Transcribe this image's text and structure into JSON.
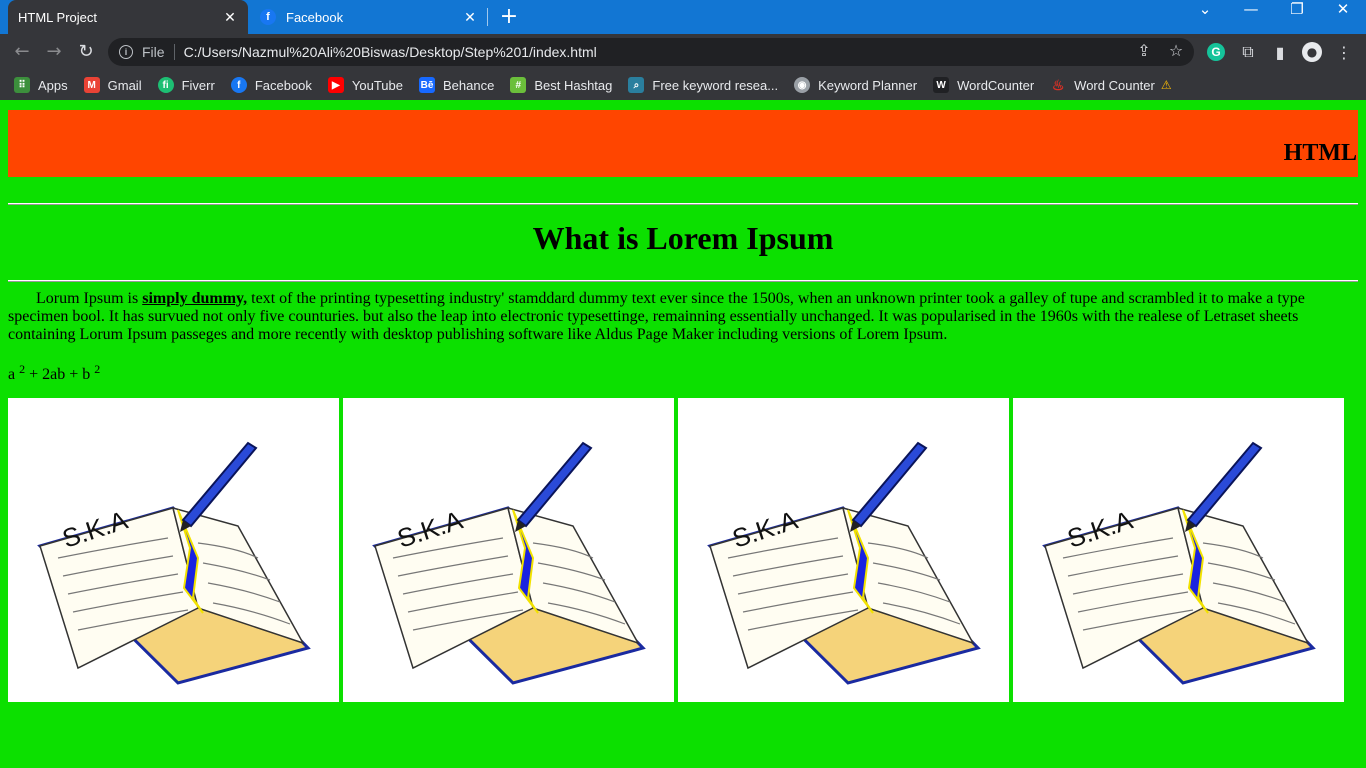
{
  "browser": {
    "tabs": [
      {
        "title": "HTML Project",
        "favicon": "page-icon",
        "active": true
      },
      {
        "title": "Facebook",
        "favicon": "facebook-icon",
        "active": false
      }
    ],
    "new_tab": "+",
    "window_controls": {
      "minimize": "—",
      "restore": "❐",
      "close": "✕"
    },
    "address": {
      "scheme": "File",
      "url": "C:/Users/Nazmul%20Ali%20Biswas/Desktop/Step%201/index.html"
    },
    "bookmarks": [
      {
        "label": "Apps",
        "icon": "apps-grid-icon",
        "color": "#f4b400"
      },
      {
        "label": "Gmail",
        "icon": "gmail-icon",
        "color": "#ea4335"
      },
      {
        "label": "Fiverr",
        "icon": "fiverr-icon",
        "color": "#1dbf73"
      },
      {
        "label": "Facebook",
        "icon": "facebook-icon",
        "color": "#1877f2"
      },
      {
        "label": "YouTube",
        "icon": "youtube-icon",
        "color": "#ff0000"
      },
      {
        "label": "Behance",
        "icon": "behance-icon",
        "color": "#1769ff"
      },
      {
        "label": "Best Hashtag",
        "icon": "hashtag-icon",
        "color": "#6bbf3b"
      },
      {
        "label": "Free keyword resea...",
        "icon": "search-icon",
        "color": "#2a7f9e"
      },
      {
        "label": "Keyword Planner",
        "icon": "keyword-planner-icon",
        "color": "#9aa0a6"
      },
      {
        "label": "WordCounter",
        "icon": "wordcounter-icon",
        "color": "#202124"
      },
      {
        "label": "Word Counter",
        "icon": "flame-icon",
        "color": "#d93025"
      }
    ]
  },
  "page": {
    "banner_text": "HTML",
    "heading": "What is Lorem Ipsum",
    "paragraph": {
      "before": "Lorum Ipsum is ",
      "emphasis": "simply dummy,",
      "after": " text of the printing typesetting industry' stamddard dummy text ever since the 1500s, when an unknown printer took a galley of tupe and scrambled it to make a type specimen bool. It has survued not only five counturies. but also the leap into electronic typesettinge, remainning essentially unchanged. It was popularised in the 1960s with the realese of Letraset sheets containing Lorum Ipsum passeges and more recently with desktop publishing software like Aldus Page Maker including versions of Lorem Ipsum."
    },
    "formula": {
      "a": "a",
      "exp1": "2",
      "mid": " + 2ab + b",
      "exp2": "2"
    },
    "images": [
      {
        "label": "S.K.A"
      },
      {
        "label": "S.K.A"
      },
      {
        "label": "S.K.A"
      },
      {
        "label": "S.K.A"
      }
    ],
    "colors": {
      "background": "#0ce000",
      "banner": "#ff4500"
    }
  }
}
